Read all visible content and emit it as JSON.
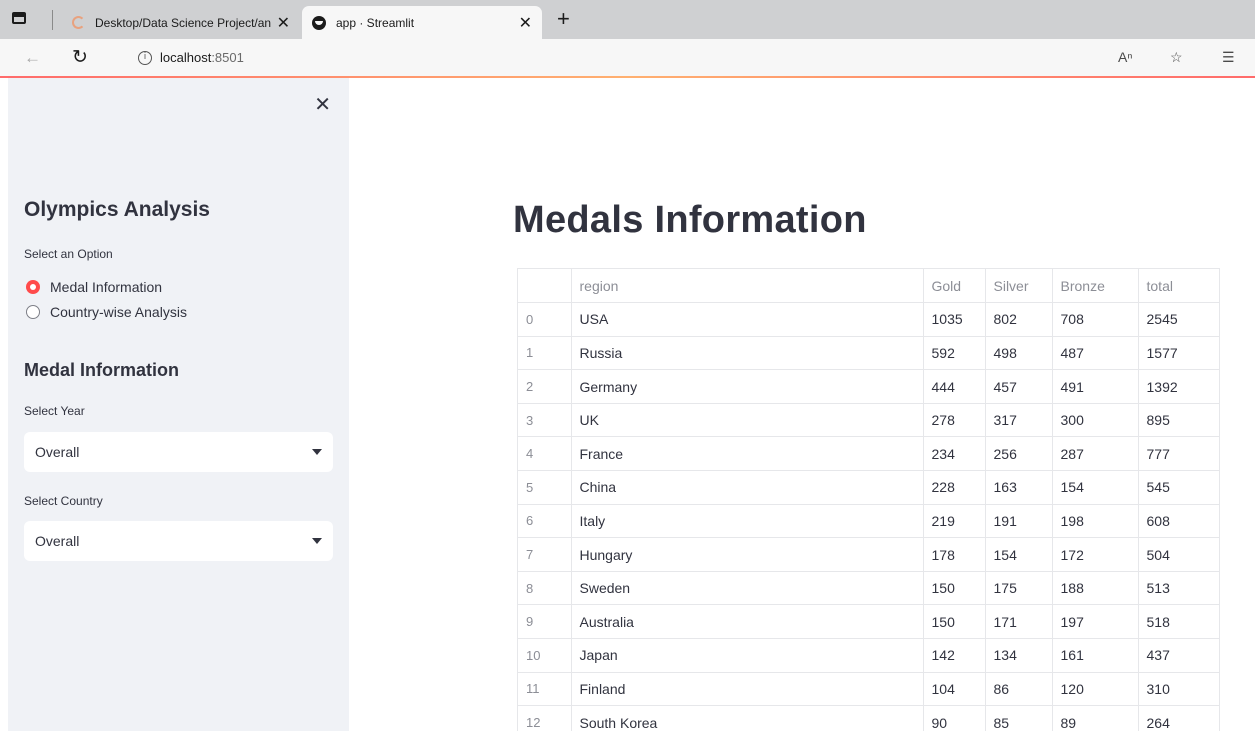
{
  "browser": {
    "tabs": [
      {
        "title": "Desktop/Data Science Project/an",
        "close": "✕"
      },
      {
        "title": "app · Streamlit",
        "close": "✕"
      }
    ],
    "new_tab": "+",
    "url_host": "localhost",
    "url_port": ":8501"
  },
  "sidebar": {
    "close": "✕",
    "title": "Olympics Analysis",
    "option_label": "Select an Option",
    "options": [
      {
        "label": "Medal Information",
        "selected": true
      },
      {
        "label": "Country-wise Analysis",
        "selected": false
      }
    ],
    "subtitle": "Medal Information",
    "year_label": "Select Year",
    "year_value": "Overall",
    "country_label": "Select Country",
    "country_value": "Overall"
  },
  "main": {
    "title": "Medals Information",
    "table": {
      "columns": [
        "",
        "region",
        "Gold",
        "Silver",
        "Bronze",
        "total"
      ],
      "rows": [
        [
          "0",
          "USA",
          "1035",
          "802",
          "708",
          "2545"
        ],
        [
          "1",
          "Russia",
          "592",
          "498",
          "487",
          "1577"
        ],
        [
          "2",
          "Germany",
          "444",
          "457",
          "491",
          "1392"
        ],
        [
          "3",
          "UK",
          "278",
          "317",
          "300",
          "895"
        ],
        [
          "4",
          "France",
          "234",
          "256",
          "287",
          "777"
        ],
        [
          "5",
          "China",
          "228",
          "163",
          "154",
          "545"
        ],
        [
          "6",
          "Italy",
          "219",
          "191",
          "198",
          "608"
        ],
        [
          "7",
          "Hungary",
          "178",
          "154",
          "172",
          "504"
        ],
        [
          "8",
          "Sweden",
          "150",
          "175",
          "188",
          "513"
        ],
        [
          "9",
          "Australia",
          "150",
          "171",
          "197",
          "518"
        ],
        [
          "10",
          "Japan",
          "142",
          "134",
          "161",
          "437"
        ],
        [
          "11",
          "Finland",
          "104",
          "86",
          "120",
          "310"
        ],
        [
          "12",
          "South Korea",
          "90",
          "85",
          "89",
          "264"
        ]
      ]
    }
  },
  "colors": {
    "accent": "#ff4b4b",
    "sidebar_bg": "#f0f2f6",
    "text": "#31333f"
  }
}
